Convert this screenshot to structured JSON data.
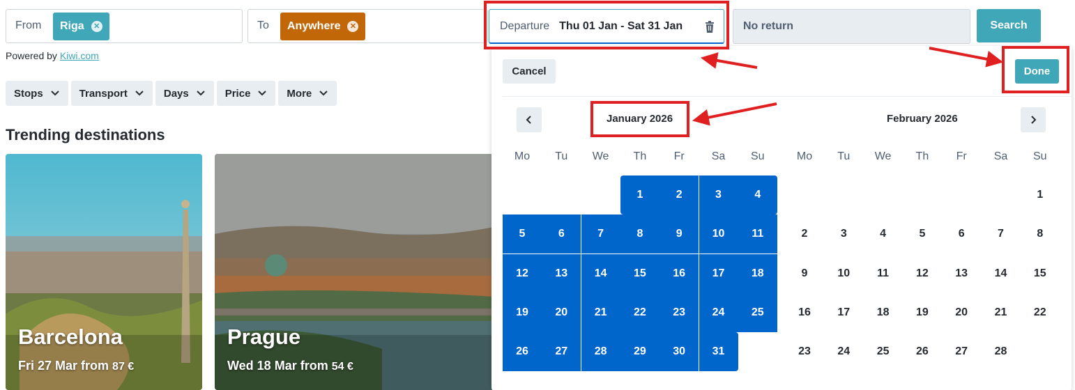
{
  "search": {
    "from_label": "From",
    "from_chip": "Riga",
    "to_label": "To",
    "to_chip": "Anywhere",
    "departure_label": "Departure",
    "departure_value": "Thu 01 Jan - Sat 31 Jan",
    "return_value": "No return",
    "search_button": "Search"
  },
  "powered": {
    "prefix": "Powered by ",
    "link": "Kiwi.com"
  },
  "filters": [
    "Stops",
    "Transport",
    "Days",
    "Price",
    "More"
  ],
  "trending": {
    "title": "Trending destinations",
    "cards": [
      {
        "city": "Barcelona",
        "date": "Fri 27 Mar from ",
        "price": "87 €"
      },
      {
        "city": "Prague",
        "date": "Wed 18 Mar from ",
        "price": "54 €"
      }
    ]
  },
  "datepicker": {
    "cancel_label": "Cancel",
    "done_label": "Done",
    "weekdays": [
      "Mo",
      "Tu",
      "We",
      "Th",
      "Fr",
      "Sa",
      "Su"
    ],
    "months": [
      {
        "title": "January 2026",
        "first_weekday_index": 3,
        "days": 31,
        "selected_from": 1,
        "selected_to": 31
      },
      {
        "title": "February 2026",
        "first_weekday_index": 6,
        "days": 28,
        "selected_from": 0,
        "selected_to": 0
      }
    ]
  },
  "colors": {
    "accent": "#3fa7b7",
    "orange_chip": "#c26707",
    "selected_day": "#0066cc",
    "annotation_red": "#e02020"
  }
}
